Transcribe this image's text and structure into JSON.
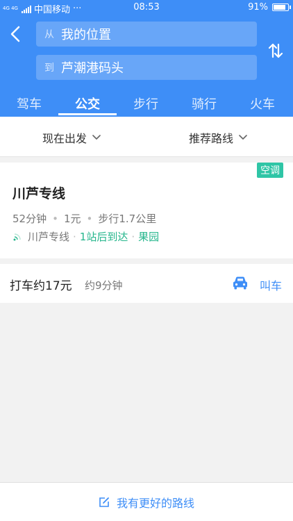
{
  "status_bar": {
    "network_badge": "4G 4G",
    "carrier": "中国移动",
    "more": "···",
    "time": "08:53",
    "battery": "91%",
    "battery_level": 0.91
  },
  "search": {
    "from_prefix": "从",
    "from_value": "我的位置",
    "to_prefix": "到",
    "to_value": "芦潮港码头"
  },
  "tabs": [
    {
      "label": "驾车"
    },
    {
      "label": "公交"
    },
    {
      "label": "步行"
    },
    {
      "label": "骑行"
    },
    {
      "label": "火车"
    }
  ],
  "active_tab": "公交",
  "filters": {
    "departure": "现在出发",
    "sort": "推荐路线"
  },
  "route": {
    "tag": "空调",
    "name": "川芦专线",
    "duration": "52分钟",
    "price": "1元",
    "walk": "步行1.7公里",
    "line": "川芦专线",
    "stops": "1站后到达",
    "station": "果园"
  },
  "taxi": {
    "price": "打车约17元",
    "time": "约9分钟",
    "call": "叫车"
  },
  "bottom": {
    "better_route": "我有更好的路线"
  },
  "colors": {
    "primary": "#3e8ef7",
    "green": "#25b68c",
    "tag": "#2fc5a6"
  }
}
